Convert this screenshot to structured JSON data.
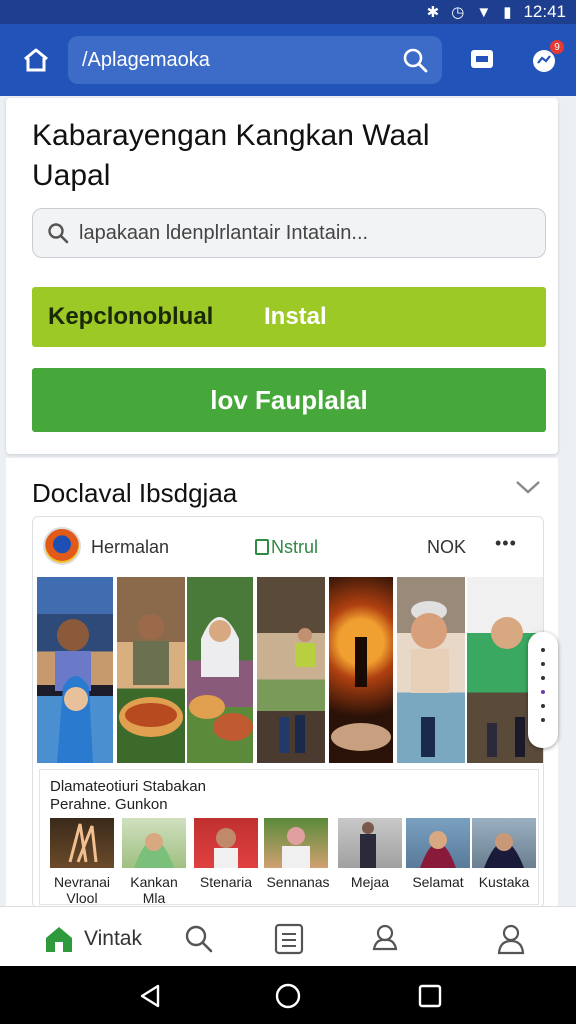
{
  "status_bar": {
    "time": "12:41"
  },
  "app_bar": {
    "search_value": "/Aplagemaoka",
    "notification_count": "9"
  },
  "main_card": {
    "title": "Kabarayengan Kangkan Waal Uapal",
    "search_placeholder": "lapakaan ldenplrlantair Intatain...",
    "button_lime_left": "Kepclonoblual",
    "button_lime_right": "Instal",
    "button_green": "lov Fauplalal"
  },
  "section": {
    "title": "Doclaval Ibsdgjaa",
    "post": {
      "author": "Hermalan",
      "tag": "Nstrul",
      "ok": "NOK",
      "more": "•••"
    },
    "sub_card": {
      "title": "Dlamateotiuri Stabakan",
      "subtitle": "Perahne. Gunkon",
      "items": [
        {
          "label": "Nevranai Vlool"
        },
        {
          "label": "Kankan Mla"
        },
        {
          "label": "Stenaria"
        },
        {
          "label": "Sennanas"
        },
        {
          "label": "Mejaa"
        },
        {
          "label": "Selamat"
        },
        {
          "label": "Kustaka"
        }
      ]
    }
  },
  "bottom_nav": {
    "home_label": "Vintak"
  },
  "colors": {
    "app_bar": "#2253b8",
    "lime": "#9cc926",
    "green": "#46a83a",
    "nav_home": "#2e9a3c"
  }
}
